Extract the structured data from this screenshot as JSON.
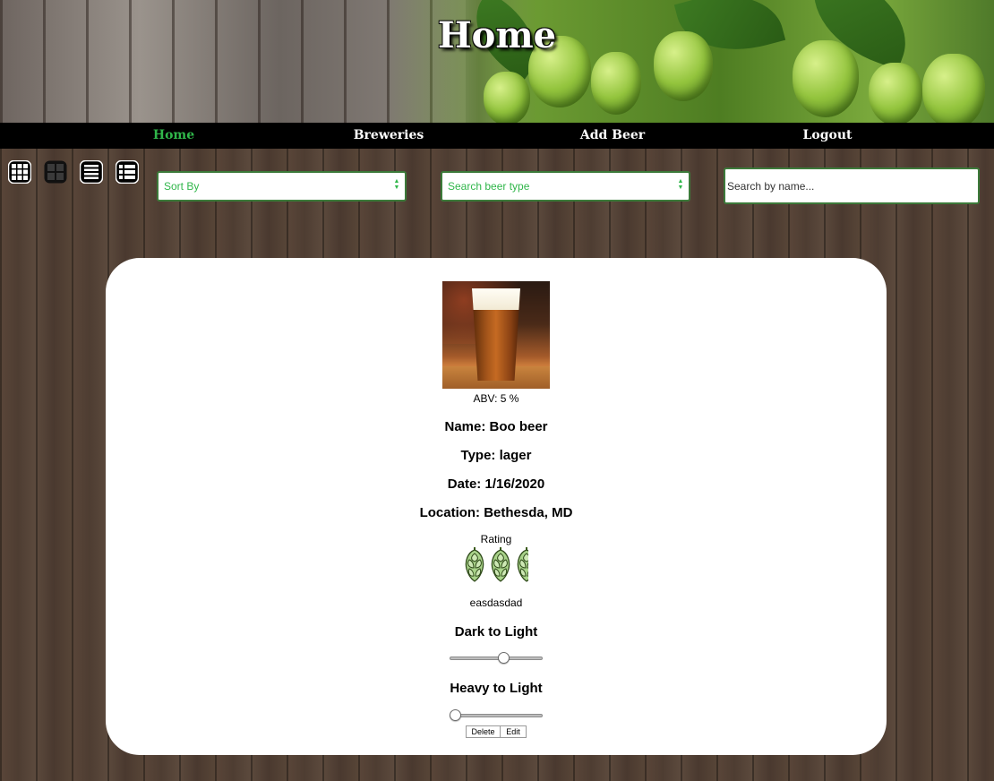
{
  "banner": {
    "title": "Home"
  },
  "nav": {
    "items": [
      {
        "label": "Home",
        "active": true
      },
      {
        "label": "Breweries",
        "active": false
      },
      {
        "label": "Add Beer",
        "active": false
      },
      {
        "label": "Logout",
        "active": false
      }
    ],
    "active_color": "#30b64a"
  },
  "toolbar": {
    "view_buttons": [
      "grid-small-icon",
      "grid-large-icon",
      "list-lines-icon",
      "list-detail-icon"
    ],
    "sort": {
      "placeholder": "Sort By"
    },
    "beer_type": {
      "placeholder": "Search beer type"
    },
    "search": {
      "placeholder": "Search by name..."
    }
  },
  "beer": {
    "abv": "ABV: 5 %",
    "name": "Name: Boo beer",
    "type": "Type: lager",
    "date": "Date: 1/16/2020",
    "location": "Location: Bethesda, MD",
    "rating_label": "Rating",
    "rating_icon": "hop-icon",
    "notes": "easdasdad",
    "color_scale_label": "Dark to Light",
    "color_scale_value": 0.59,
    "body_scale_label": "Heavy to Light",
    "body_scale_value": 0.0,
    "delete_label": "Delete",
    "edit_label": "Edit"
  }
}
